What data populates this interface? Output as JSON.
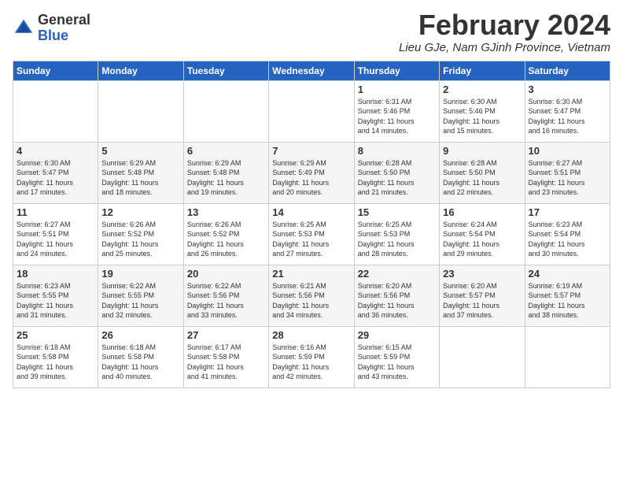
{
  "header": {
    "logo_line1": "General",
    "logo_line2": "Blue",
    "month_title": "February 2024",
    "location": "Lieu GJe, Nam GJinh Province, Vietnam"
  },
  "weekdays": [
    "Sunday",
    "Monday",
    "Tuesday",
    "Wednesday",
    "Thursday",
    "Friday",
    "Saturday"
  ],
  "weeks": [
    [
      {
        "day": "",
        "info": ""
      },
      {
        "day": "",
        "info": ""
      },
      {
        "day": "",
        "info": ""
      },
      {
        "day": "",
        "info": ""
      },
      {
        "day": "1",
        "info": "Sunrise: 6:31 AM\nSunset: 5:46 PM\nDaylight: 11 hours\nand 14 minutes."
      },
      {
        "day": "2",
        "info": "Sunrise: 6:30 AM\nSunset: 5:46 PM\nDaylight: 11 hours\nand 15 minutes."
      },
      {
        "day": "3",
        "info": "Sunrise: 6:30 AM\nSunset: 5:47 PM\nDaylight: 11 hours\nand 16 minutes."
      }
    ],
    [
      {
        "day": "4",
        "info": "Sunrise: 6:30 AM\nSunset: 5:47 PM\nDaylight: 11 hours\nand 17 minutes."
      },
      {
        "day": "5",
        "info": "Sunrise: 6:29 AM\nSunset: 5:48 PM\nDaylight: 11 hours\nand 18 minutes."
      },
      {
        "day": "6",
        "info": "Sunrise: 6:29 AM\nSunset: 5:48 PM\nDaylight: 11 hours\nand 19 minutes."
      },
      {
        "day": "7",
        "info": "Sunrise: 6:29 AM\nSunset: 5:49 PM\nDaylight: 11 hours\nand 20 minutes."
      },
      {
        "day": "8",
        "info": "Sunrise: 6:28 AM\nSunset: 5:50 PM\nDaylight: 11 hours\nand 21 minutes."
      },
      {
        "day": "9",
        "info": "Sunrise: 6:28 AM\nSunset: 5:50 PM\nDaylight: 11 hours\nand 22 minutes."
      },
      {
        "day": "10",
        "info": "Sunrise: 6:27 AM\nSunset: 5:51 PM\nDaylight: 11 hours\nand 23 minutes."
      }
    ],
    [
      {
        "day": "11",
        "info": "Sunrise: 6:27 AM\nSunset: 5:51 PM\nDaylight: 11 hours\nand 24 minutes."
      },
      {
        "day": "12",
        "info": "Sunrise: 6:26 AM\nSunset: 5:52 PM\nDaylight: 11 hours\nand 25 minutes."
      },
      {
        "day": "13",
        "info": "Sunrise: 6:26 AM\nSunset: 5:52 PM\nDaylight: 11 hours\nand 26 minutes."
      },
      {
        "day": "14",
        "info": "Sunrise: 6:25 AM\nSunset: 5:53 PM\nDaylight: 11 hours\nand 27 minutes."
      },
      {
        "day": "15",
        "info": "Sunrise: 6:25 AM\nSunset: 5:53 PM\nDaylight: 11 hours\nand 28 minutes."
      },
      {
        "day": "16",
        "info": "Sunrise: 6:24 AM\nSunset: 5:54 PM\nDaylight: 11 hours\nand 29 minutes."
      },
      {
        "day": "17",
        "info": "Sunrise: 6:23 AM\nSunset: 5:54 PM\nDaylight: 11 hours\nand 30 minutes."
      }
    ],
    [
      {
        "day": "18",
        "info": "Sunrise: 6:23 AM\nSunset: 5:55 PM\nDaylight: 11 hours\nand 31 minutes."
      },
      {
        "day": "19",
        "info": "Sunrise: 6:22 AM\nSunset: 5:55 PM\nDaylight: 11 hours\nand 32 minutes."
      },
      {
        "day": "20",
        "info": "Sunrise: 6:22 AM\nSunset: 5:56 PM\nDaylight: 11 hours\nand 33 minutes."
      },
      {
        "day": "21",
        "info": "Sunrise: 6:21 AM\nSunset: 5:56 PM\nDaylight: 11 hours\nand 34 minutes."
      },
      {
        "day": "22",
        "info": "Sunrise: 6:20 AM\nSunset: 5:56 PM\nDaylight: 11 hours\nand 36 minutes."
      },
      {
        "day": "23",
        "info": "Sunrise: 6:20 AM\nSunset: 5:57 PM\nDaylight: 11 hours\nand 37 minutes."
      },
      {
        "day": "24",
        "info": "Sunrise: 6:19 AM\nSunset: 5:57 PM\nDaylight: 11 hours\nand 38 minutes."
      }
    ],
    [
      {
        "day": "25",
        "info": "Sunrise: 6:18 AM\nSunset: 5:58 PM\nDaylight: 11 hours\nand 39 minutes."
      },
      {
        "day": "26",
        "info": "Sunrise: 6:18 AM\nSunset: 5:58 PM\nDaylight: 11 hours\nand 40 minutes."
      },
      {
        "day": "27",
        "info": "Sunrise: 6:17 AM\nSunset: 5:58 PM\nDaylight: 11 hours\nand 41 minutes."
      },
      {
        "day": "28",
        "info": "Sunrise: 6:16 AM\nSunset: 5:59 PM\nDaylight: 11 hours\nand 42 minutes."
      },
      {
        "day": "29",
        "info": "Sunrise: 6:15 AM\nSunset: 5:59 PM\nDaylight: 11 hours\nand 43 minutes."
      },
      {
        "day": "",
        "info": ""
      },
      {
        "day": "",
        "info": ""
      }
    ]
  ]
}
